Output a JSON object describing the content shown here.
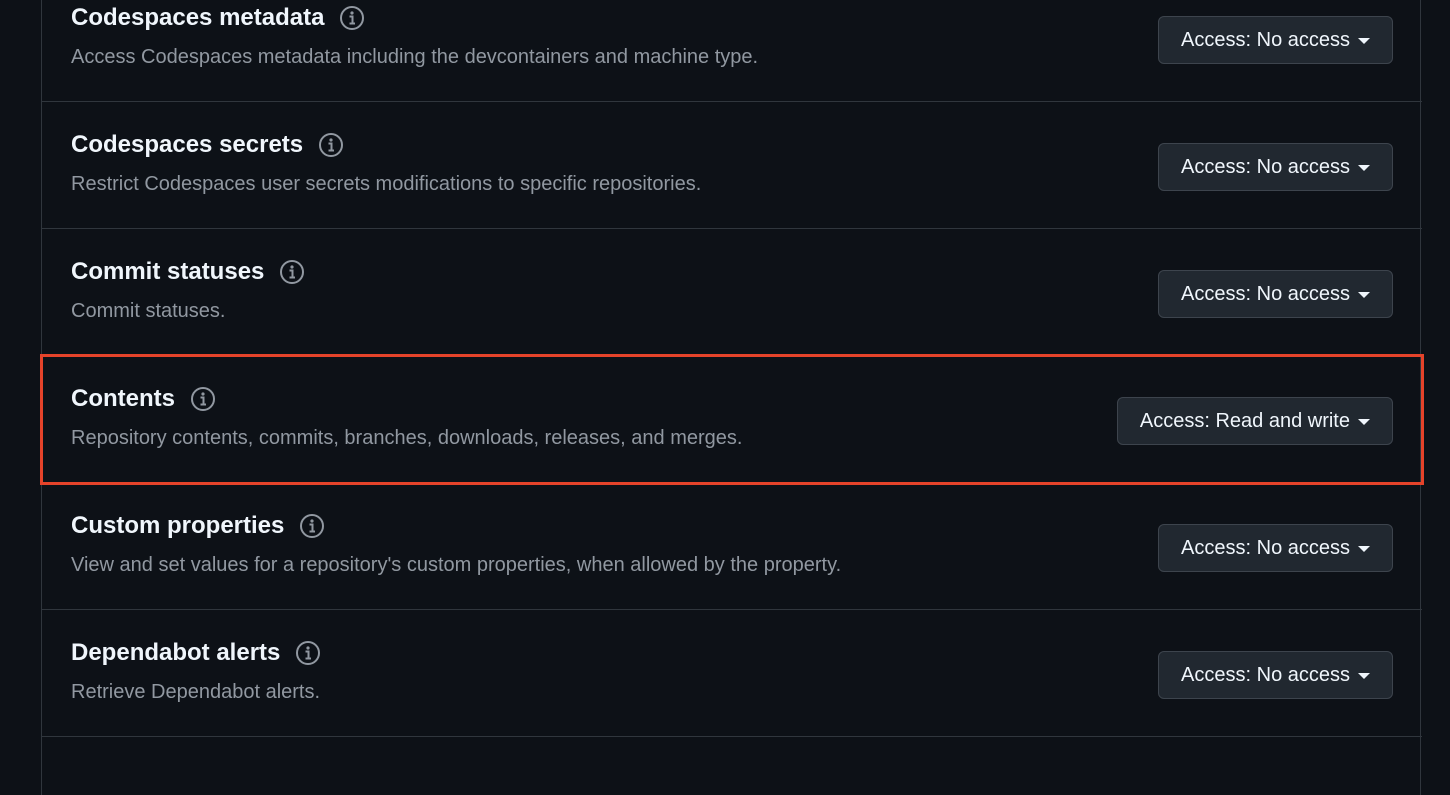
{
  "permissions": [
    {
      "title": "Codespaces metadata",
      "description": "Access Codespaces metadata including the devcontainers and machine type.",
      "access": "Access: No access",
      "info_icon": "info-icon"
    },
    {
      "title": "Codespaces secrets",
      "description": "Restrict Codespaces user secrets modifications to specific repositories.",
      "access": "Access: No access",
      "info_icon": "info-icon"
    },
    {
      "title": "Commit statuses",
      "description": "Commit statuses.",
      "access": "Access: No access",
      "info_icon": "info-icon"
    },
    {
      "title": "Contents",
      "description": "Repository contents, commits, branches, downloads, releases, and merges.",
      "access": "Access: Read and write",
      "info_icon": "info-icon",
      "highlighted": true
    },
    {
      "title": "Custom properties",
      "description": "View and set values for a repository's custom properties, when allowed by the property.",
      "access": "Access: No access",
      "info_icon": "info-icon"
    },
    {
      "title": "Dependabot alerts",
      "description": "Retrieve Dependabot alerts.",
      "access": "Access: No access",
      "info_icon": "info-icon"
    }
  ],
  "colors": {
    "background": "#0d1117",
    "border": "#30363d",
    "highlight": "#e5432a",
    "button_bg": "#212830",
    "muted_text": "#9198a1"
  }
}
